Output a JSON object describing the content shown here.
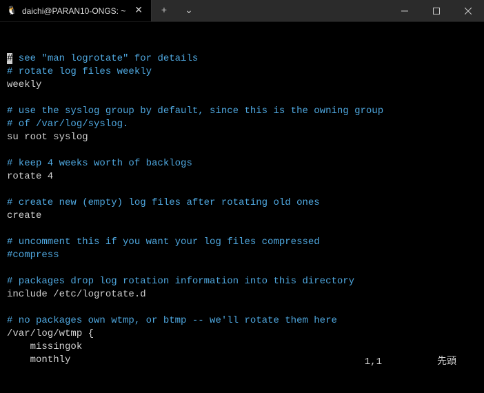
{
  "titlebar": {
    "tab": {
      "icon": "🐧",
      "title": "daichi@PARAN10-ONGS: ~",
      "close": "✕"
    },
    "newtab": "+",
    "dropdown": "⌄"
  },
  "content": {
    "lines": [
      {
        "cls": "comment",
        "text": "# see \"man logrotate\" for details",
        "cursorAtStart": true
      },
      {
        "cls": "comment",
        "text": "# rotate log files weekly"
      },
      {
        "cls": "plain",
        "text": "weekly"
      },
      {
        "cls": "plain",
        "text": ""
      },
      {
        "cls": "comment",
        "text": "# use the syslog group by default, since this is the owning group"
      },
      {
        "cls": "comment",
        "text": "# of /var/log/syslog."
      },
      {
        "cls": "plain",
        "text": "su root syslog"
      },
      {
        "cls": "plain",
        "text": ""
      },
      {
        "cls": "comment",
        "text": "# keep 4 weeks worth of backlogs"
      },
      {
        "cls": "plain",
        "text": "rotate 4"
      },
      {
        "cls": "plain",
        "text": ""
      },
      {
        "cls": "comment",
        "text": "# create new (empty) log files after rotating old ones"
      },
      {
        "cls": "plain",
        "text": "create"
      },
      {
        "cls": "plain",
        "text": ""
      },
      {
        "cls": "comment",
        "text": "# uncomment this if you want your log files compressed"
      },
      {
        "cls": "comment",
        "text": "#compress"
      },
      {
        "cls": "plain",
        "text": ""
      },
      {
        "cls": "comment",
        "text": "# packages drop log rotation information into this directory"
      },
      {
        "cls": "plain",
        "text": "include /etc/logrotate.d"
      },
      {
        "cls": "plain",
        "text": ""
      },
      {
        "cls": "comment",
        "text": "# no packages own wtmp, or btmp -- we'll rotate them here"
      },
      {
        "cls": "plain",
        "text": "/var/log/wtmp {"
      },
      {
        "cls": "plain",
        "text": "    missingok"
      },
      {
        "cls": "plain",
        "text": "    monthly"
      }
    ]
  },
  "status": {
    "position": "1,1",
    "mode": "先頭"
  }
}
